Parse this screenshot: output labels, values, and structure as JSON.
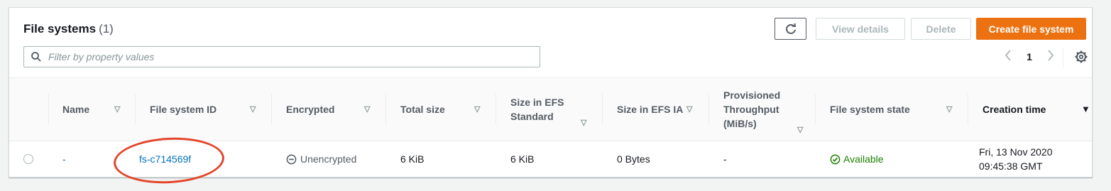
{
  "header": {
    "title": "File systems",
    "count": "(1)"
  },
  "toolbar": {
    "refresh_icon": "refresh-icon",
    "view_details_label": "View details",
    "delete_label": "Delete",
    "create_label": "Create file system"
  },
  "filter": {
    "placeholder": "Filter by property values",
    "icon": "search-icon"
  },
  "pagination": {
    "prev_icon": "chevron-left-icon",
    "current_page": "1",
    "next_icon": "chevron-right-icon",
    "settings_icon": "gear-icon"
  },
  "table": {
    "columns": [
      "Name",
      "File system ID",
      "Encrypted",
      "Total size",
      "Size in EFS Standard",
      "Size in EFS IA",
      "Provisioned Throughput (MiB/s)",
      "File system state",
      "Creation time"
    ],
    "sorted_column": "Creation time",
    "rows": [
      {
        "name": "-",
        "id": "fs-c714569f",
        "encrypted": "Unencrypted",
        "total_size": "6 KiB",
        "size_standard": "6 KiB",
        "size_ia": "0 Bytes",
        "throughput": "-",
        "state": "Available",
        "creation_time_line1": "Fri, 13 Nov 2020",
        "creation_time_line2": "09:45:38 GMT"
      }
    ]
  },
  "colors": {
    "primary_button": "#ec7211",
    "link": "#0073bb",
    "success": "#1d8102",
    "annotation": "#e4452a"
  }
}
